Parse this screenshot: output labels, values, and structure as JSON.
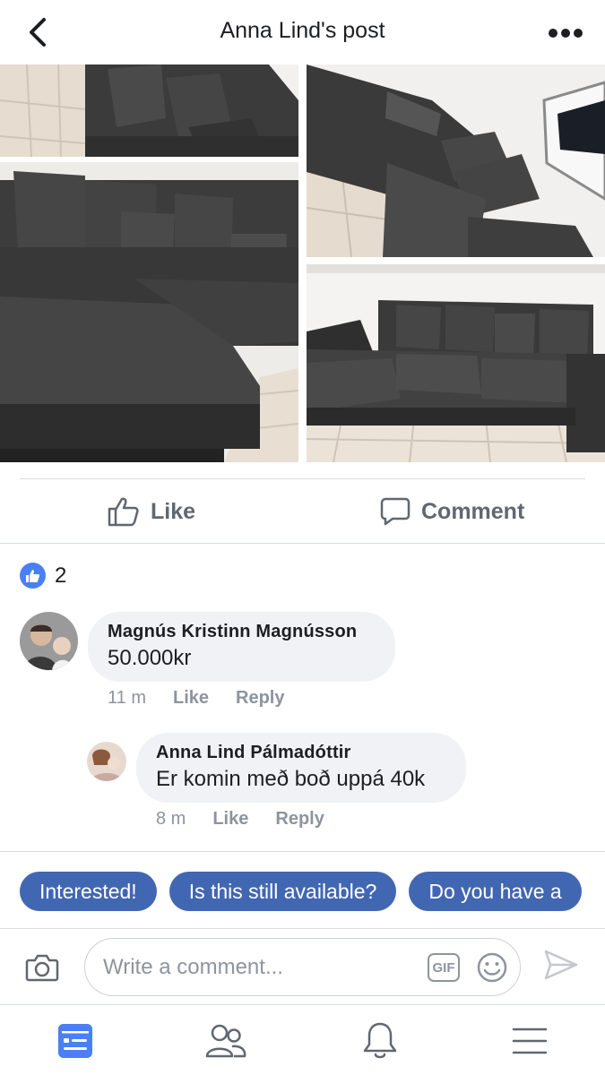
{
  "header": {
    "title": "Anna Lind's post",
    "back_icon": "chevron-left-icon",
    "more_icon": "more-horizontal-icon"
  },
  "photos": [
    {
      "name": "sofa-photo-1"
    },
    {
      "name": "sofa-photo-2"
    },
    {
      "name": "sofa-photo-3"
    },
    {
      "name": "sofa-photo-4"
    }
  ],
  "actions": {
    "like_label": "Like",
    "comment_label": "Comment"
  },
  "reactions": {
    "count": "2",
    "type": "like"
  },
  "comments": [
    {
      "author": "Magnús Kristinn Magnússon",
      "text": "50.000kr",
      "time": "11 m",
      "like_label": "Like",
      "reply_label": "Reply"
    },
    {
      "author": "Anna Lind Pálmadóttir",
      "text": "Er komin með boð uppá 40k",
      "time": "8 m",
      "like_label": "Like",
      "reply_label": "Reply"
    }
  ],
  "quick_replies": [
    "Interested!",
    "Is this still available?",
    "Do you have a"
  ],
  "composer": {
    "placeholder": "Write a comment...",
    "gif_label": "GIF"
  },
  "tabbar": {
    "items": [
      "feed-icon",
      "friends-icon",
      "notifications-icon",
      "menu-icon"
    ],
    "active": "feed-icon"
  },
  "colors": {
    "accent": "#4267b2",
    "like_blue": "#4a7ff5",
    "bubble_bg": "#f0f2f5",
    "muted_text": "#8d949e",
    "sofa": "#3d3d3d"
  }
}
